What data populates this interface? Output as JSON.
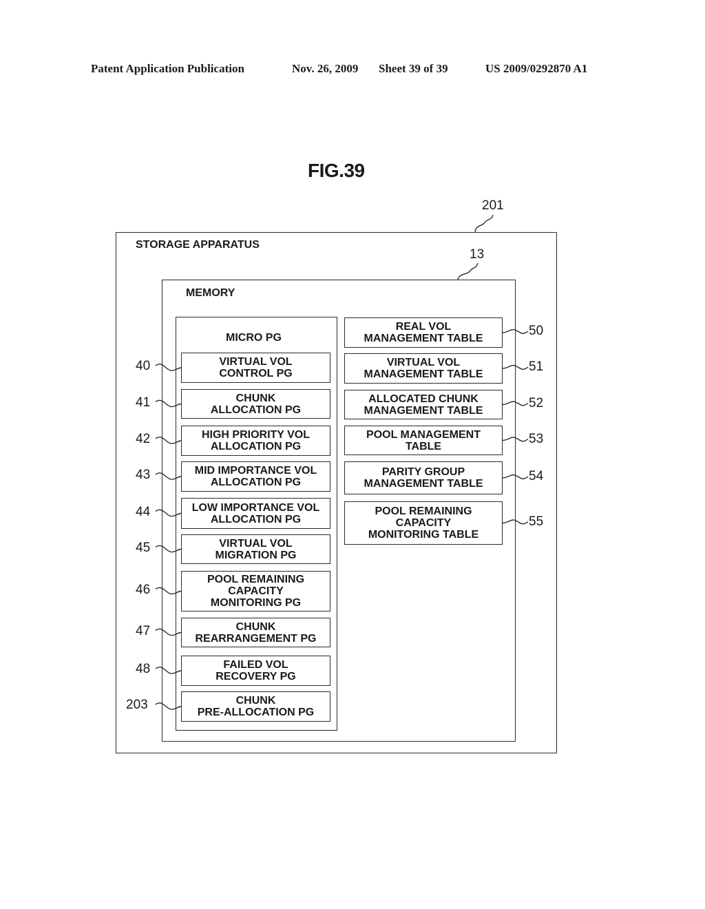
{
  "header": {
    "publication": "Patent Application Publication",
    "date": "Nov. 26, 2009",
    "sheet": "Sheet 39 of 39",
    "number": "US 2009/0292870 A1"
  },
  "figure": {
    "title": "FIG.39"
  },
  "storage_apparatus": {
    "label": "STORAGE APPARATUS",
    "ref": "201"
  },
  "memory": {
    "label": "MEMORY",
    "ref": "13"
  },
  "micro_pg": {
    "label": "MICRO PG",
    "items": [
      {
        "ref": "40",
        "label": "VIRTUAL VOL\nCONTROL PG"
      },
      {
        "ref": "41",
        "label": "CHUNK\nALLOCATION PG"
      },
      {
        "ref": "42",
        "label": "HIGH PRIORITY VOL\nALLOCATION PG"
      },
      {
        "ref": "43",
        "label": "MID IMPORTANCE VOL\nALLOCATION PG"
      },
      {
        "ref": "44",
        "label": "LOW IMPORTANCE VOL\nALLOCATION PG"
      },
      {
        "ref": "45",
        "label": "VIRTUAL VOL\nMIGRATION PG"
      },
      {
        "ref": "46",
        "label": "POOL REMAINING\nCAPACITY\nMONITORING PG"
      },
      {
        "ref": "47",
        "label": "CHUNK\nREARRANGEMENT PG"
      },
      {
        "ref": "48",
        "label": "FAILED VOL\nRECOVERY PG"
      },
      {
        "ref": "203",
        "label": "CHUNK\nPRE-ALLOCATION PG"
      }
    ]
  },
  "tables": [
    {
      "ref": "50",
      "label": "REAL VOL\nMANAGEMENT TABLE"
    },
    {
      "ref": "51",
      "label": "VIRTUAL VOL\nMANAGEMENT TABLE"
    },
    {
      "ref": "52",
      "label": "ALLOCATED CHUNK\nMANAGEMENT TABLE"
    },
    {
      "ref": "53",
      "label": "POOL MANAGEMENT\nTABLE"
    },
    {
      "ref": "54",
      "label": "PARITY GROUP\nMANAGEMENT TABLE"
    },
    {
      "ref": "55",
      "label": "POOL REMAINING\nCAPACITY\nMONITORING TABLE"
    }
  ]
}
